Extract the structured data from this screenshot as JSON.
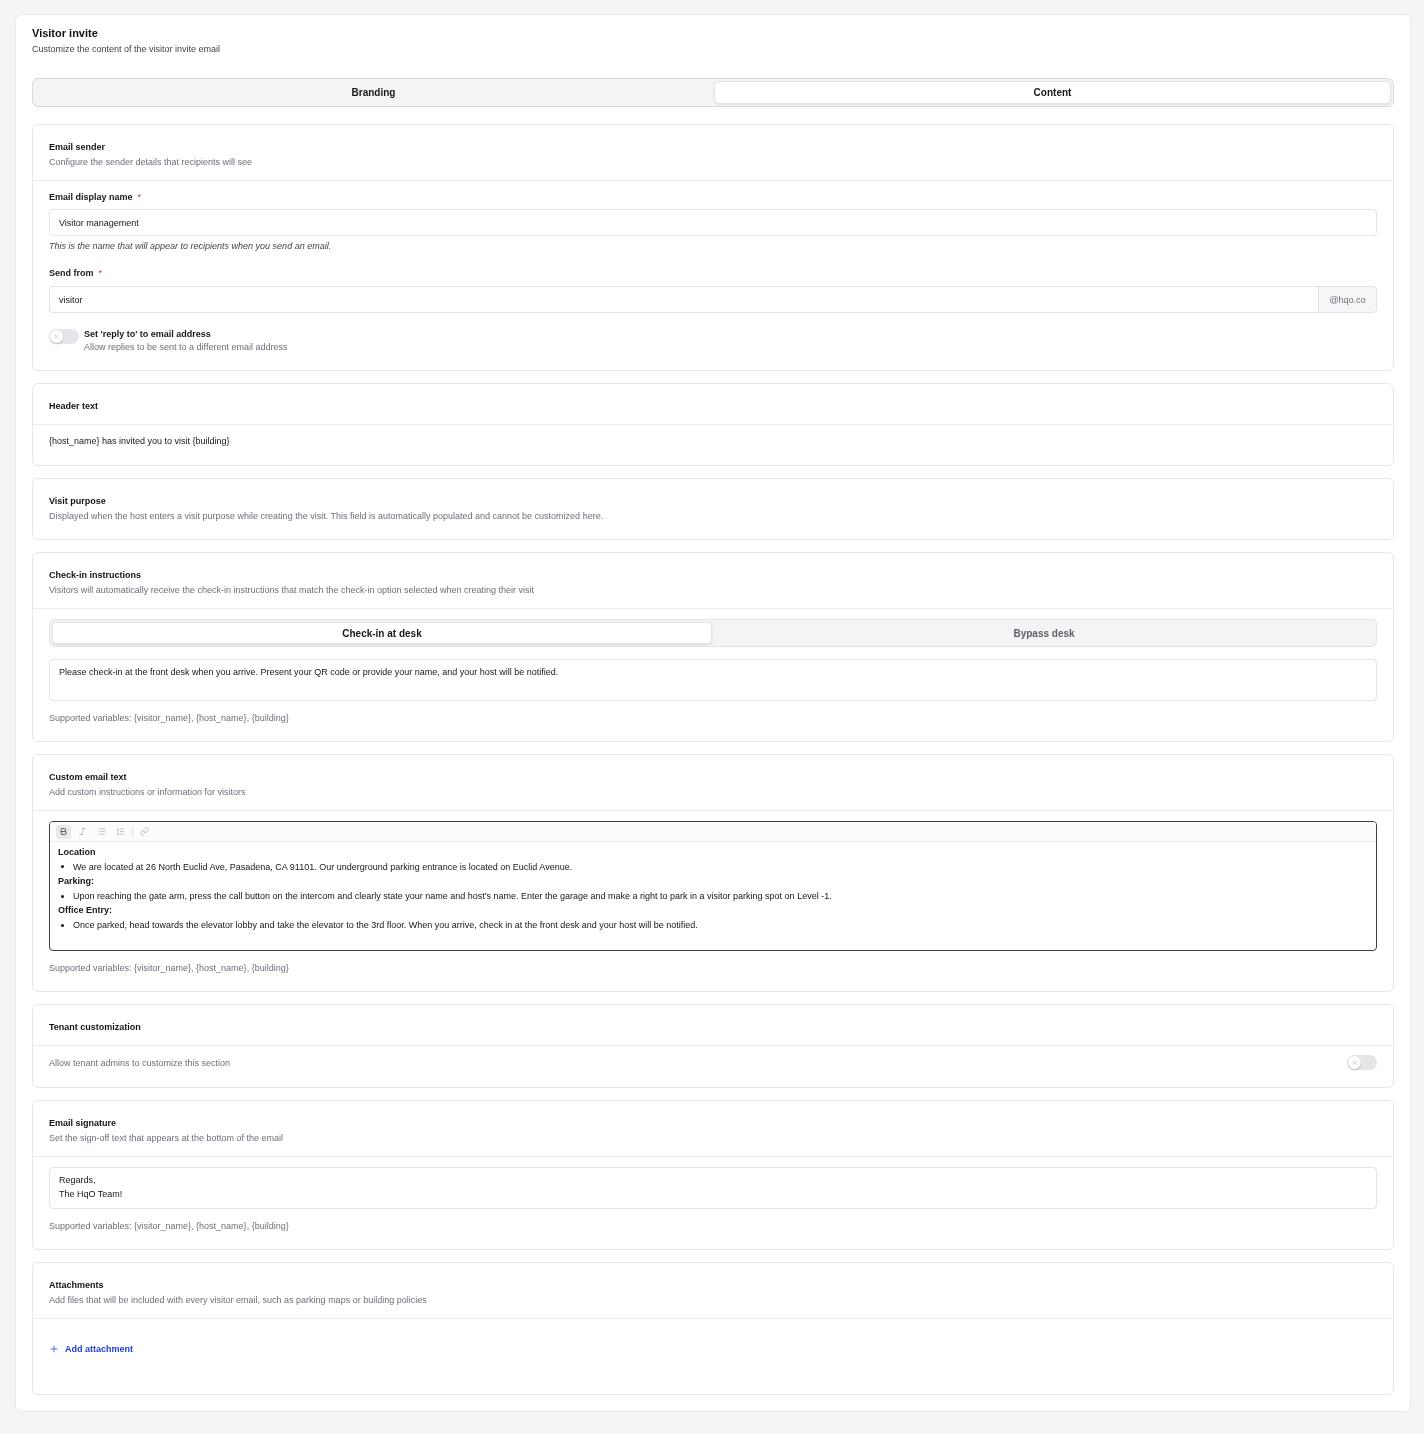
{
  "header": {
    "title": "Visitor invite",
    "subtitle": "Customize the content of the visitor invite email"
  },
  "tabs": [
    {
      "label": "Branding",
      "selected": false
    },
    {
      "label": "Content",
      "selected": true
    }
  ],
  "sections": [
    {
      "kind": "sender",
      "title": "Email sender",
      "subtitle": "Configure the sender details that recipients will see",
      "display_name": {
        "label": "Email display name",
        "required_mark": "*",
        "value": "Visitor management",
        "hint": "This is the name that will appear to recipients when you send an email."
      },
      "send_from": {
        "label": "Send from",
        "required_mark": "*",
        "value": "visitor",
        "suffix": "@hqo.co"
      },
      "reply_to": {
        "label": "Set 'reply to' to email address",
        "description": "Allow replies to be sent to a different email address",
        "on": false
      }
    },
    {
      "kind": "text",
      "title": "Header text",
      "value": "{host_name} has invited you to visit {building}"
    },
    {
      "kind": "info",
      "title": "Visit purpose",
      "subtitle": "Displayed when the host enters a visit purpose while creating the visit. This field is automatically populated and cannot be customized here."
    },
    {
      "kind": "checkin",
      "title": "Check-in instructions",
      "subtitle": "Visitors will automatically receive the check-in instructions that match the check-in option selected when creating their visit",
      "options": [
        {
          "label": "Check-in at desk",
          "selected": true
        },
        {
          "label": "Bypass desk",
          "selected": false
        }
      ],
      "value": "Please check-in at the front desk when you arrive. Present your QR code or provide your name, and your host will be notified.",
      "hint": "Supported variables: {visitor_name}, {host_name}, {building}"
    },
    {
      "kind": "rich_text",
      "title": "Custom email text",
      "subtitle": "Add custom instructions or information for visitors",
      "toolbar": [
        {
          "items": [
            {
              "kind": "bold",
              "active": true
            },
            {
              "kind": "italic",
              "active": false
            },
            {
              "kind": "bullet_list",
              "active": false
            },
            {
              "kind": "numbered_list",
              "active": false
            }
          ]
        },
        {
          "items": [
            {
              "kind": "link",
              "active": false
            }
          ]
        }
      ],
      "content": [
        {
          "kind": "heading",
          "text": "Location"
        },
        {
          "kind": "bullet",
          "text": "We are located at 26 North Euclid Ave, Pasadena, CA 91101. Our underground parking entrance is located on Euclid Avenue."
        },
        {
          "kind": "heading",
          "text": "Parking:"
        },
        {
          "kind": "bullet",
          "text": "Upon reaching the gate arm, press the call button on the intercom and clearly state your name and host's name. Enter the garage and make a right to park in a visitor parking spot on Level -1."
        },
        {
          "kind": "heading",
          "text": "Office Entry:"
        },
        {
          "kind": "bullet",
          "text": "Once parked, head towards the elevator lobby and take the elevator to the 3rd floor. When you arrive, check in at the front desk and your host will be notified."
        }
      ],
      "hint": "Supported variables: {visitor_name}, {host_name}, {building}"
    },
    {
      "kind": "toggle",
      "title": "Tenant customization",
      "description": "Allow tenant admins to customize this section",
      "on": false
    },
    {
      "kind": "signature",
      "title": "Email signature",
      "subtitle": "Set the sign-off text that appears at the bottom of the email",
      "lines": [
        "Regards,",
        "The HqO Team!"
      ],
      "hint": "Supported variables: {visitor_name}, {host_name}, {building}"
    },
    {
      "kind": "attachments",
      "title": "Attachments",
      "subtitle": "Add files that will be included with every visitor email, such as parking maps or building policies",
      "action": {
        "label": "Add attachment"
      }
    }
  ]
}
